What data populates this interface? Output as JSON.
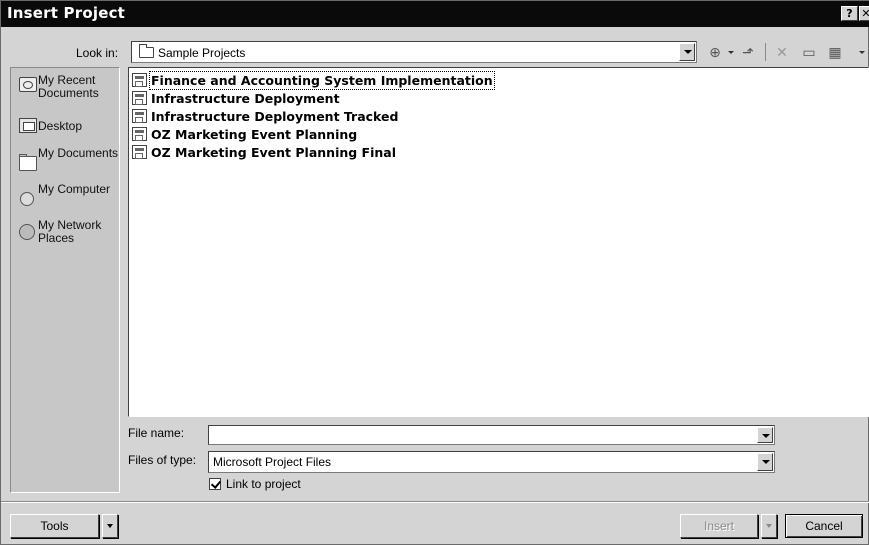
{
  "window": {
    "title": "Insert Project",
    "help_glyph": "?",
    "close_glyph": "✕"
  },
  "lookin": {
    "label": "Look in:",
    "value": "Sample Projects"
  },
  "toolbar": {
    "icons": [
      "back-icon",
      "up-folder-icon",
      "delete-icon",
      "new-folder-icon",
      "views-icon"
    ]
  },
  "places": [
    {
      "icon": "recent-documents-icon",
      "label": "My Recent Documents"
    },
    {
      "icon": "desktop-icon",
      "label": "Desktop"
    },
    {
      "icon": "my-documents-icon",
      "label": "My Documents"
    },
    {
      "icon": "my-computer-icon",
      "label": "My Computer"
    },
    {
      "icon": "my-network-places-icon",
      "label": "My Network Places"
    }
  ],
  "files": [
    {
      "name": "Finance and Accounting System Implementation",
      "selected": true
    },
    {
      "name": "Infrastructure Deployment",
      "selected": false
    },
    {
      "name": "Infrastructure Deployment Tracked",
      "selected": false
    },
    {
      "name": "OZ Marketing Event Planning",
      "selected": false
    },
    {
      "name": "OZ Marketing Event Planning Final",
      "selected": false
    }
  ],
  "filename": {
    "label": "File name:",
    "value": ""
  },
  "filetype": {
    "label": "Files of type:",
    "value": "Microsoft Project Files"
  },
  "link_to_project": {
    "label": "Link to project",
    "checked": true
  },
  "buttons": {
    "tools": "Tools",
    "insert": "Insert",
    "cancel": "Cancel"
  }
}
